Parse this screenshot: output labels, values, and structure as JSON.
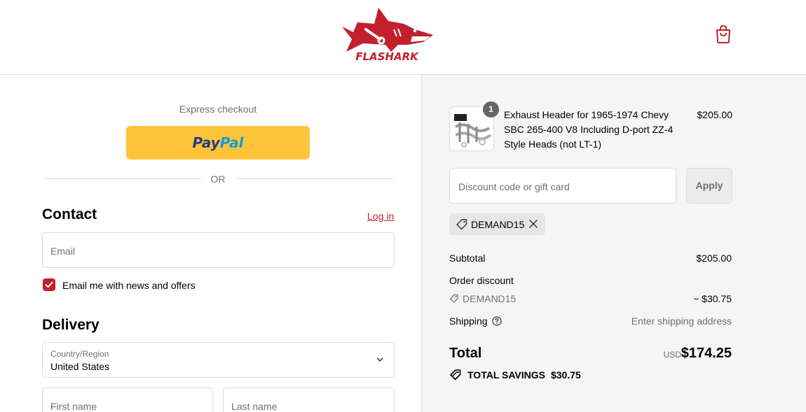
{
  "brand": {
    "name": "FLASHARK",
    "color": "#c3202e"
  },
  "header": {
    "cart_icon": "shopping-bag-icon"
  },
  "express": {
    "label": "Express checkout",
    "paypal_part1": "Pay",
    "paypal_part2": "Pal",
    "or": "OR"
  },
  "contact": {
    "title": "Contact",
    "login_link": "Log in",
    "email_placeholder": "Email",
    "newsletter_label": "Email me with news and offers",
    "newsletter_checked": true
  },
  "delivery": {
    "title": "Delivery",
    "country_label": "Country/Region",
    "country_value": "United States",
    "first_name_placeholder": "First name",
    "last_name_placeholder": "Last name"
  },
  "summary": {
    "item": {
      "quantity": "1",
      "title": "Exhaust Header for 1965-1974 Chevy SBC 265-400 V8 Including D-port ZZ-4 Style Heads (not LT-1)",
      "price": "$205.00"
    },
    "discount_placeholder": "Discount code or gift card",
    "apply_label": "Apply",
    "applied_code": "DEMAND15",
    "subtotal_label": "Subtotal",
    "subtotal_value": "$205.00",
    "order_discount_label": "Order discount",
    "order_discount_code": "DEMAND15",
    "order_discount_value": "− $30.75",
    "shipping_label": "Shipping",
    "shipping_value": "Enter shipping address",
    "total_label": "Total",
    "currency": "USD",
    "total_value": "$174.25",
    "savings_label": "TOTAL SAVINGS",
    "savings_value": "$30.75"
  }
}
